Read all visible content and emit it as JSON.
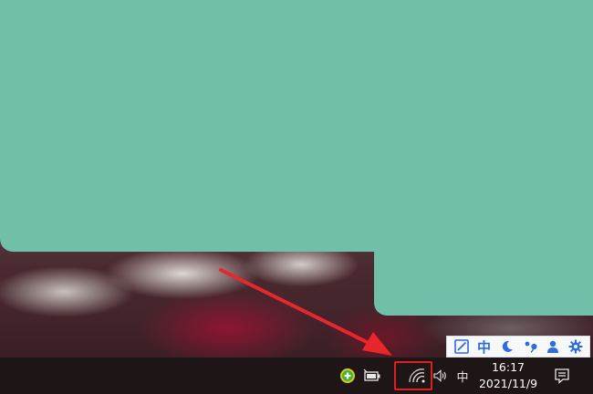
{
  "desktop": {
    "teal_color": "#72bfa9"
  },
  "ime_toolbar": {
    "buttons": [
      {
        "icon": "pen-icon"
      },
      {
        "icon": "chinese-mode-icon",
        "label": "中"
      },
      {
        "icon": "moon-icon"
      },
      {
        "icon": "punctuation-icon"
      },
      {
        "icon": "user-icon"
      },
      {
        "icon": "gear-icon"
      }
    ]
  },
  "taskbar": {
    "tray": {
      "ime_indicator": "中",
      "wifi_icon": "wifi-icon",
      "volume_icon": "volume-icon",
      "battery_icon": "battery-icon",
      "app_icon": "green-plus-app-icon"
    },
    "clock": {
      "time": "16:17",
      "date": "2021/11/9"
    },
    "notification_icon": "action-center-icon"
  },
  "annotation": {
    "arrow_color": "#e8262b",
    "highlight_color": "#e02020",
    "highlighted": "wifi-icon"
  }
}
